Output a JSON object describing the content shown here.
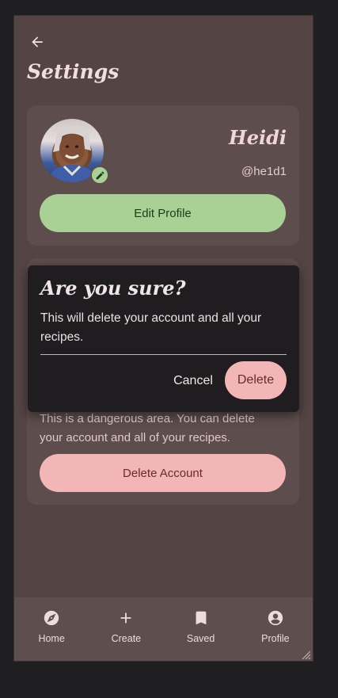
{
  "header": {
    "back_icon": "arrow-left-icon",
    "title": "Settings"
  },
  "profile": {
    "name": "Heidi",
    "handle": "@he1d1",
    "avatar_icon": "avatar-photo",
    "edit_icon": "pencil-icon",
    "edit_button": "Edit Profile"
  },
  "danger": {
    "description": "This is a dangerous area. You can delete your account and all of your recipes.",
    "delete_button": "Delete Account"
  },
  "dialog": {
    "title": "Are you sure?",
    "body": "This will delete your account and all your recipes.",
    "cancel": "Cancel",
    "confirm": "Delete"
  },
  "nav": {
    "items": [
      {
        "label": "Home",
        "icon": "compass-icon"
      },
      {
        "label": "Create",
        "icon": "plus-icon"
      },
      {
        "label": "Saved",
        "icon": "bookmark-icon"
      },
      {
        "label": "Profile",
        "icon": "account-circle-icon"
      }
    ]
  },
  "colors": {
    "background": "#554444",
    "card": "#5e4d4d",
    "accent_green": "#a9d195",
    "accent_pink": "#f2b6b6",
    "dialog": "#1f1d20"
  }
}
